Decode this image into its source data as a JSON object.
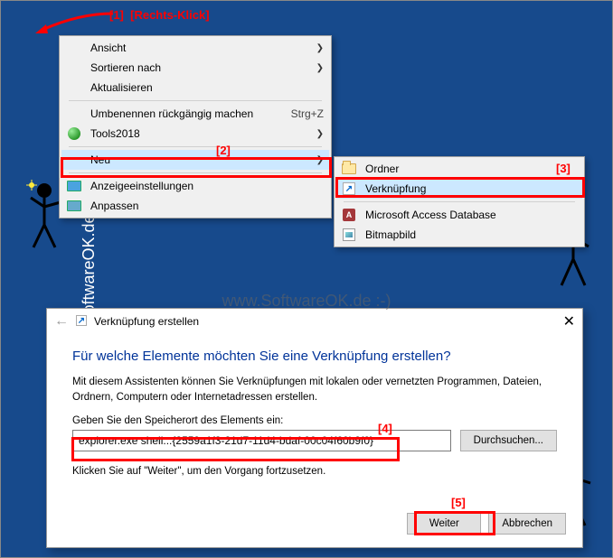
{
  "annotations": {
    "a1": "[1]",
    "a1_label": "[Rechts-Klick]",
    "a2": "[2]",
    "a3": "[3]",
    "a4": "[4]",
    "a5": "[5]"
  },
  "contextMenu": {
    "ansicht": "Ansicht",
    "sortieren": "Sortieren nach",
    "aktualisieren": "Aktualisieren",
    "umbenennen": "Umbenennen rückgängig machen",
    "umbenennen_shortcut": "Strg+Z",
    "tools": "Tools2018",
    "neu": "Neu",
    "anzeige": "Anzeigeeinstellungen",
    "anpassen": "Anpassen"
  },
  "subMenu": {
    "ordner": "Ordner",
    "verknupfung": "Verknüpfung",
    "access": "Microsoft Access Database",
    "bitmap": "Bitmapbild"
  },
  "dialog": {
    "title": "Verknüpfung erstellen",
    "heading": "Für welche Elemente möchten Sie eine Verknüpfung erstellen?",
    "desc": "Mit diesem Assistenten können Sie Verknüpfungen mit lokalen oder vernetzten Programmen, Dateien, Ordnern, Computern oder Internetadressen erstellen.",
    "inputLabel": "Geben Sie den Speicherort des Elements ein:",
    "inputValue": "explorer.exe shell:::{2559a1f3-21d7-11d4-bdaf-00c04f60b9f0}",
    "browse": "Durchsuchen...",
    "hint": "Klicken Sie auf \"Weiter\", um den Vorgang fortzusetzen.",
    "next": "Weiter",
    "cancel": "Abbrechen"
  },
  "watermark": "www.SoftwareOK.de :-)"
}
